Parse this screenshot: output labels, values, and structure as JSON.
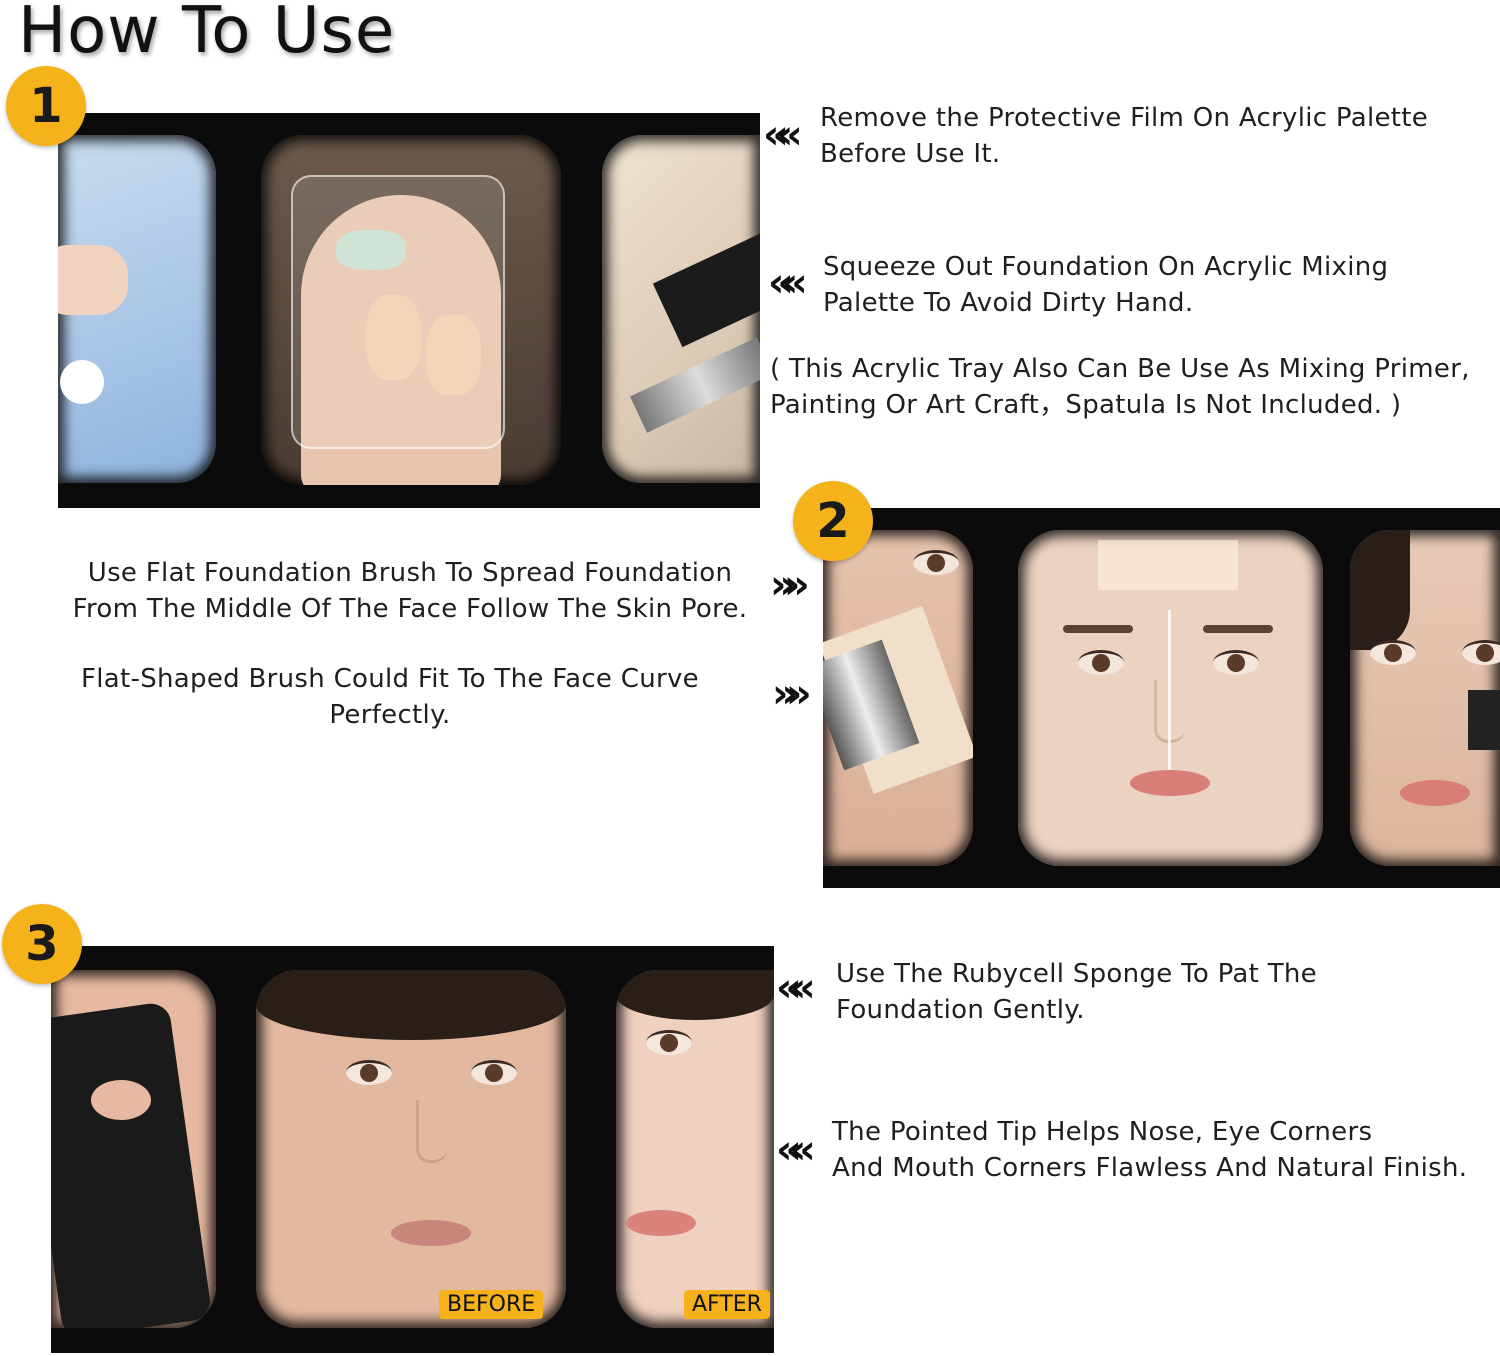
{
  "title": "How To Use",
  "steps": [
    {
      "number": "1"
    },
    {
      "number": "2"
    },
    {
      "number": "3"
    }
  ],
  "step1": {
    "text_a": "Remove the Protective Film On Acrylic Palette\nBefore Use  It.",
    "text_b": "Squeeze Out  Foundation On Acrylic Mixing\nPalette To Avoid Dirty Hand.",
    "text_c": "( This Acrylic Tray Also Can Be Use As Mixing Primer,\nPainting Or Art Craft，Spatula Is Not Included. )",
    "arrow_left": "«"
  },
  "step2": {
    "text_a": "Use Flat Foundation Brush To Spread Foundation\nFrom The Middle Of The Face Follow The Skin Pore.",
    "text_b": "Flat-Shaped Brush Could Fit To The Face Curve\nPerfectly.",
    "arrow_right": "»"
  },
  "step3": {
    "text_a": "Use  The  Rubycell  Sponge  To  Pat  The\nFoundation Gently.",
    "text_b": "The Pointed Tip Helps Nose, Eye Corners\nAnd Mouth Corners Flawless And Natural Finish.",
    "arrow_left": "«",
    "before_label": "BEFORE",
    "after_label": "AFTER"
  },
  "colors": {
    "badge": "#f5b21b",
    "strip": "#0b0b0b",
    "skin": "#e9c1a8"
  }
}
